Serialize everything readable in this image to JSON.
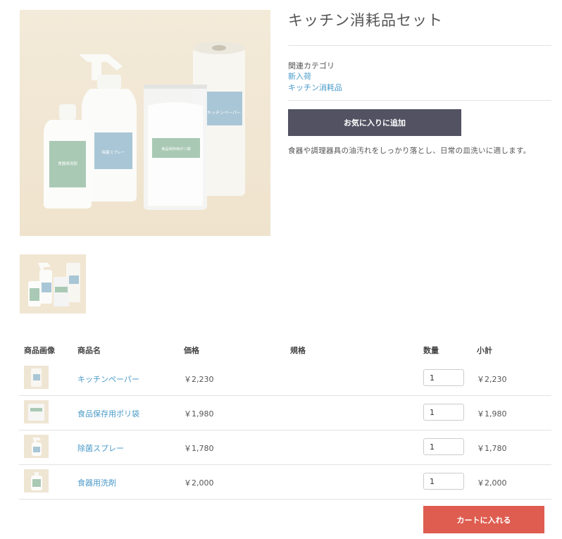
{
  "product": {
    "title": "キッチン消耗品セット",
    "category_label": "関連カテゴリ",
    "categories": [
      "新入荷",
      "キッチン消耗品"
    ],
    "favorite_label": "お気に入りに追加",
    "description": "食器や調理器具の油汚れをしっかり落とし、日常の皿洗いに適します。"
  },
  "image_labels": {
    "detergent": "食器用洗剤",
    "spray": "除菌スプレー",
    "bag": "食品保存用ポリ袋",
    "paper": "キッチンペーパー"
  },
  "table": {
    "headers": {
      "image": "商品画像",
      "name": "商品名",
      "price": "価格",
      "spec": "規格",
      "qty": "数量",
      "subtotal": "小計"
    },
    "rows": [
      {
        "name": "キッチンペーパー",
        "price": "￥2,230",
        "qty": "1",
        "subtotal": "￥2,230",
        "icon": "paper-towel-icon"
      },
      {
        "name": "食品保存用ポリ袋",
        "price": "￥1,980",
        "qty": "1",
        "subtotal": "￥1,980",
        "icon": "storage-bag-icon"
      },
      {
        "name": "除菌スプレー",
        "price": "￥1,780",
        "qty": "1",
        "subtotal": "￥1,780",
        "icon": "spray-bottle-icon"
      },
      {
        "name": "食器用洗剤",
        "price": "￥2,000",
        "qty": "1",
        "subtotal": "￥2,000",
        "icon": "detergent-bottle-icon"
      }
    ]
  },
  "cart_label": "カートに入れる",
  "colors": {
    "favorite_button": "#525263",
    "cart_button": "#de5d50",
    "link": "#4a9ac9"
  }
}
